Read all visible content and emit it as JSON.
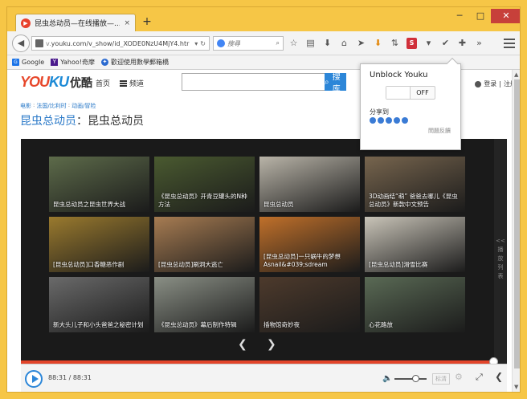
{
  "browser": {
    "tab_title": "昆虫总动员—在线播放—...",
    "tab_close": "×",
    "new_tab": "+",
    "window_minimize": "─",
    "window_maximize": "□",
    "window_close": "✕",
    "url_scheme": "v.",
    "url_rest": "youku.com/v_show/id_XODE0NzU4MjY4.htr",
    "search_placeholder": "搜尋",
    "bookmarks": [
      {
        "label": "Google",
        "icon": "G"
      },
      {
        "label": "Yahoo!奇摩",
        "icon": "Y"
      },
      {
        "label": "歡迎使用數學郵箱橋",
        "icon": "✦"
      }
    ]
  },
  "youku": {
    "logo_en_a": "YOU",
    "logo_en_b": "KU",
    "logo_cn": "优酷",
    "nav_home": "首页",
    "nav_channel": "频道",
    "search_button": "搜库",
    "login": "登录",
    "sep": "|",
    "register": "注册",
    "breadcrumb": [
      "电影",
      "法国/比利时",
      "动画/冒险"
    ],
    "breadcrumb_sep": ":",
    "title_blue": "昆虫总动员",
    "title_rest": "：昆虫总动员",
    "side_tab": [
      "<<",
      "播",
      "放",
      "列",
      "表"
    ],
    "thumbnails": [
      {
        "caption": "昆虫总动员之昆虫世界大战",
        "bg": "#5d6b4a"
      },
      {
        "caption": "《昆虫总动员》开青豆罐头的N种方法",
        "bg": "#4a5a30"
      },
      {
        "caption": "昆虫总动员",
        "bg": "#b9b4a8"
      },
      {
        "caption": "3D动画结“萌” 爸爸去哪儿《昆虫总动员》新款中文预告",
        "bg": "#77654e"
      },
      {
        "caption": "[昆虫总动员]口香糖恶作剧",
        "bg": "#9a7a2e"
      },
      {
        "caption": "[昆虫总动员]刷洞大逃亡",
        "bg": "#a77c52"
      },
      {
        "caption": "[昆虫总动员]一只蜗牛的梦想Asnail&#039;sdream",
        "bg": "#c0702a"
      },
      {
        "caption": "[昆虫总动员]滑雪比赛",
        "bg": "#c9c4b8"
      },
      {
        "caption": "新大头儿子和小头爸爸之秘密计划",
        "bg": "#6a6a6a"
      },
      {
        "caption": "《昆虫总动员》幕后制作特辑",
        "bg": "#8a8f85"
      },
      {
        "caption": "插物馆奇妙夜",
        "bg": "#4d3a2c"
      },
      {
        "caption": "心花路放",
        "bg": "#5a6a55"
      }
    ],
    "prev_arrow": "❮",
    "next_arrow": "❯",
    "time": "88:31 / 88:31",
    "hd_label": "标清",
    "progress_fraction": 1.0
  },
  "popup": {
    "title": "Unblock Youku",
    "toggle_state": "OFF",
    "share_label": "分享到",
    "feedback": "問題反饋"
  }
}
